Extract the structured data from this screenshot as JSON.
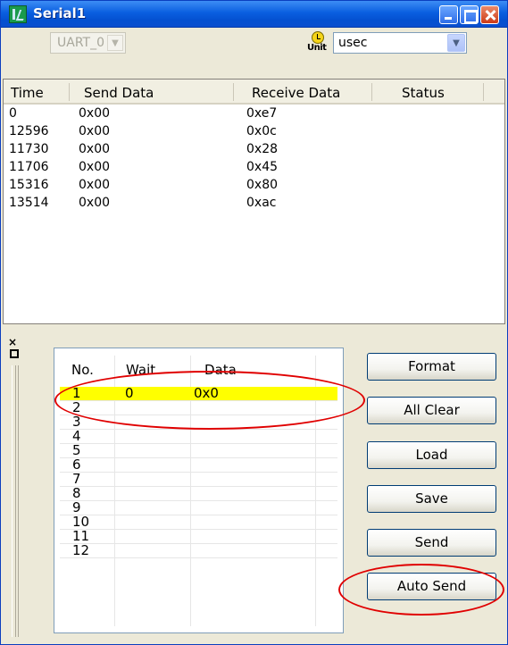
{
  "window": {
    "title": "Serial1"
  },
  "toolbar": {
    "port_value": "UART_0",
    "unit_icon_label": "Unit",
    "unit_value": "usec"
  },
  "log_table": {
    "columns": [
      "Time",
      "Send Data",
      "Receive Data",
      "Status"
    ],
    "rows": [
      [
        "0",
        "0x00",
        "0xe7",
        ""
      ],
      [
        "12596",
        "0x00",
        "0x0c",
        ""
      ],
      [
        "11730",
        "0x00",
        "0x28",
        ""
      ],
      [
        "11706",
        "0x00",
        "0x45",
        ""
      ],
      [
        "15316",
        "0x00",
        "0x80",
        ""
      ],
      [
        "13514",
        "0x00",
        "0xac",
        ""
      ]
    ]
  },
  "sidebar": {
    "close_glyph": "×"
  },
  "send_table": {
    "columns": [
      "No.",
      "Wait",
      "Data"
    ],
    "rows": [
      [
        "1",
        "0",
        "0x0"
      ],
      [
        "2",
        "",
        ""
      ],
      [
        "3",
        "",
        ""
      ],
      [
        "4",
        "",
        ""
      ],
      [
        "5",
        "",
        ""
      ],
      [
        "6",
        "",
        ""
      ],
      [
        "7",
        "",
        ""
      ],
      [
        "8",
        "",
        ""
      ],
      [
        "9",
        "",
        ""
      ],
      [
        "10",
        "",
        ""
      ],
      [
        "11",
        "",
        ""
      ],
      [
        "12",
        "",
        ""
      ]
    ],
    "selected_row_color": "#ffff00"
  },
  "buttons": {
    "format": "Format",
    "all_clear": "All Clear",
    "load": "Load",
    "save": "Save",
    "send": "Send",
    "auto_send": "Auto Send"
  },
  "annotation_color": "#e00000"
}
